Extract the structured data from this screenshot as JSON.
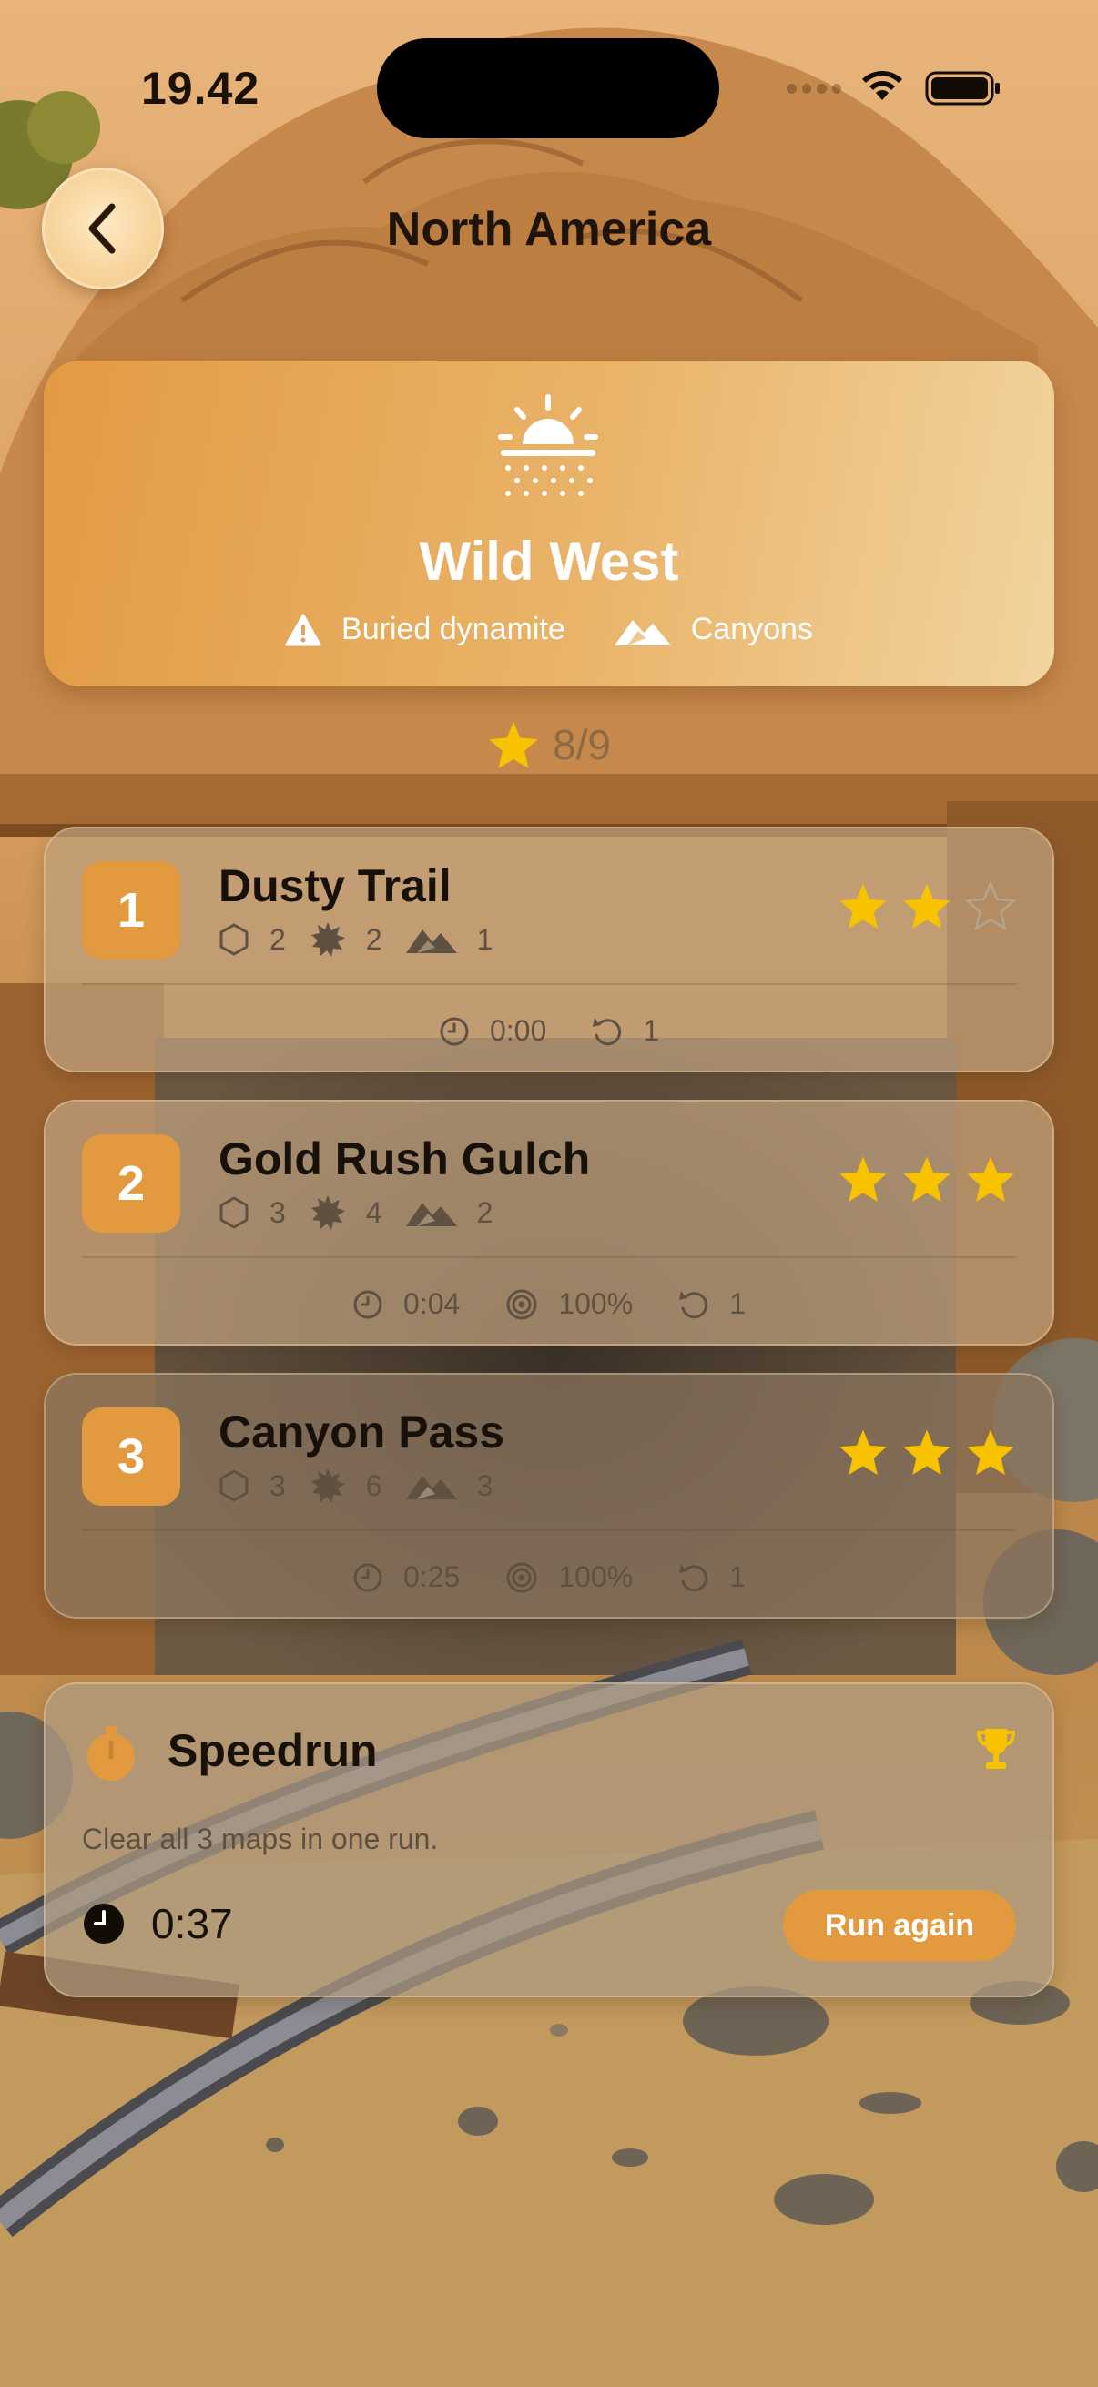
{
  "status_bar": {
    "time": "19.42"
  },
  "header": {
    "title": "North America"
  },
  "region": {
    "name": "Wild West",
    "tags": [
      {
        "icon": "warning-icon",
        "label": "Buried dynamite"
      },
      {
        "icon": "mountains-icon",
        "label": "Canyons"
      }
    ]
  },
  "progress": {
    "stars_text": "8/9"
  },
  "levels": [
    {
      "number": "1",
      "name": "Dusty Trail",
      "hexes": "2",
      "mines": "2",
      "canyons": "1",
      "stars_earned": 2,
      "stars_total": 3,
      "time": "0:00",
      "accuracy": "",
      "retries": "1"
    },
    {
      "number": "2",
      "name": "Gold Rush Gulch",
      "hexes": "3",
      "mines": "4",
      "canyons": "2",
      "stars_earned": 3,
      "stars_total": 3,
      "time": "0:04",
      "accuracy": "100%",
      "retries": "1"
    },
    {
      "number": "3",
      "name": "Canyon Pass",
      "hexes": "3",
      "mines": "6",
      "canyons": "3",
      "stars_earned": 3,
      "stars_total": 3,
      "time": "0:25",
      "accuracy": "100%",
      "retries": "1"
    }
  ],
  "speedrun": {
    "title": "Speedrun",
    "description": "Clear all 3 maps in one run.",
    "best_time": "0:37",
    "button_label": "Run again"
  },
  "colors": {
    "accent": "#e39a3e",
    "star_gold": "#f7c200",
    "star_empty": "#b4a58f"
  }
}
